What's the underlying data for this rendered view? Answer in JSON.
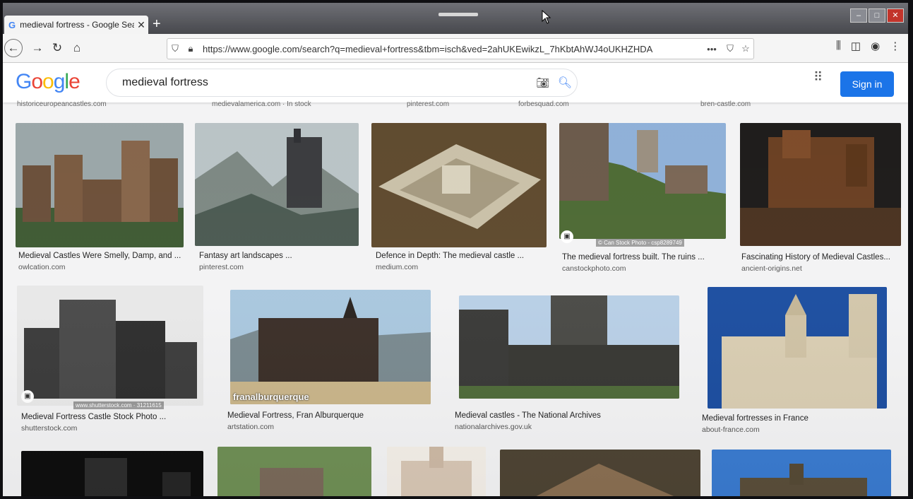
{
  "browser": {
    "tab_title": "medieval fortress - Google Sear",
    "tab_close": "✕",
    "new_tab": "+",
    "url": "https://www.google.com/search?q=medieval+fortress&tbm=isch&ved=2ahUKEwikzL_7hKbtAhWJ4oUKHZHDA",
    "url_more": "•••"
  },
  "google": {
    "logo": [
      "G",
      "o",
      "o",
      "g",
      "l",
      "e"
    ],
    "query": "medieval fortress",
    "sign_in": "Sign in"
  },
  "prev_sources": [
    "historiceuropeancastles.com",
    "medievalamerica.com · In stock",
    "pinterest.com",
    "forbesquad.com",
    "bren-castle.com"
  ],
  "results_row1": [
    {
      "caption": "Medieval Castles Were Smelly, Damp, and ...",
      "source": "owlcation.com"
    },
    {
      "caption": "Fantasy art landscapes ...",
      "source": "pinterest.com"
    },
    {
      "caption": "Defence in Depth: The medieval castle ...",
      "source": "medium.com"
    },
    {
      "caption": "The medieval fortress built. The ruins ...",
      "source": "canstockphoto.com",
      "watermark": "© Can Stock Photo - csp8289749"
    },
    {
      "caption": "Fascinating History of Medieval Castles...",
      "source": "ancient-origins.net"
    }
  ],
  "results_row2": [
    {
      "caption": "Medieval Fortress Castle Stock Photo ...",
      "source": "shutterstock.com",
      "watermark": "www.shutterstock.com · 31211615"
    },
    {
      "caption": "Medieval Fortress, Fran Alburquerque",
      "source": "artstation.com",
      "watermark": "franalburquerque"
    },
    {
      "caption": "Medieval castles - The National Archives",
      "source": "nationalarchives.gov.uk"
    },
    {
      "caption": "Medieval fortresses in France",
      "source": "about-france.com"
    }
  ],
  "colors": {
    "google_blue": "#4285f4",
    "signin": "#1a73e8"
  }
}
